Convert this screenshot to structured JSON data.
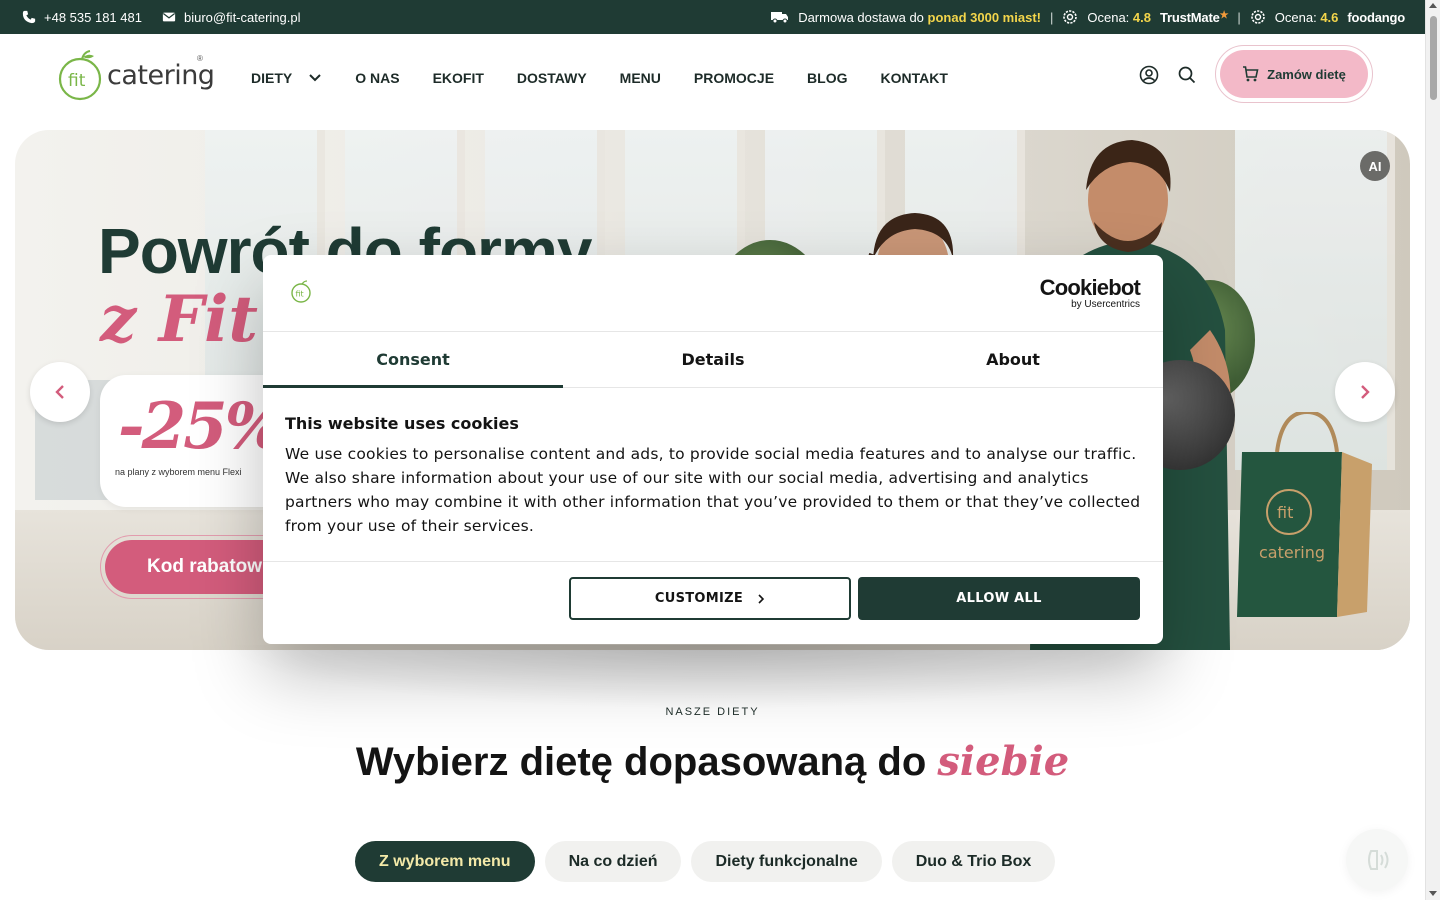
{
  "topbar": {
    "phone": "+48 535 181 481",
    "email": "biuro@fit-catering.pl",
    "delivery_prefix": "Darmowa dostawa do",
    "delivery_highlight": "ponad 3000 miast!",
    "separator": "|",
    "rating_label_1": "Ocena:",
    "rating_value_1": "4.8",
    "rating_brand_1": "TrustMate",
    "rating_label_2": "Ocena:",
    "rating_value_2": "4.6",
    "rating_brand_2": "foodango"
  },
  "header": {
    "logo_word": "catering",
    "logo_fit": "fit",
    "logo_reg": "®",
    "nav": [
      {
        "label": "DIETY"
      },
      {
        "label": "O NAS"
      },
      {
        "label": "EKOFIT"
      },
      {
        "label": "DOSTAWY"
      },
      {
        "label": "MENU"
      },
      {
        "label": "PROMOCJE"
      },
      {
        "label": "BLOG"
      },
      {
        "label": "KONTAKT"
      }
    ],
    "order_label": "Zamów dietę"
  },
  "hero": {
    "title_line1": "Powrót do formy",
    "title_line2": "z Fit C",
    "discount": "-25%",
    "discount_note": "na plany z wyborem menu Flexi",
    "code_button": "Kod rabatow",
    "ai_badge": "AI",
    "bag_logo_fit": "fit",
    "bag_logo_word": "catering"
  },
  "cookie_dialog": {
    "brand_name": "Cookiebot",
    "brand_by": "by Usercentrics",
    "tabs": [
      {
        "label": "Consent",
        "active": true
      },
      {
        "label": "Details",
        "active": false
      },
      {
        "label": "About",
        "active": false
      }
    ],
    "heading": "This website uses cookies",
    "body": "We use cookies to personalise content and ads, to provide social media features and to analyse our traffic. We also share information about your use of our site with our social media, advertising and analytics partners who may combine it with other information that you’ve provided to them or that they’ve collected from your use of their services.",
    "customize_label": "CUSTOMIZE",
    "allow_all_label": "ALLOW ALL"
  },
  "diets": {
    "kicker": "NASZE DIETY",
    "title_main": "Wybierz dietę dopasowaną do",
    "title_accent": "siebie",
    "pills": [
      {
        "label": "Z wyborem menu",
        "active": true
      },
      {
        "label": "Na co dzień",
        "active": false
      },
      {
        "label": "Diety funkcjonalne",
        "active": false
      },
      {
        "label": "Duo & Trio Box",
        "active": false
      }
    ]
  },
  "colors": {
    "brand_dark": "#1f3b34",
    "brand_pink": "#d35c7c",
    "highlight_yellow": "#f3d54b",
    "order_pink": "#f3b9c8"
  },
  "icons": {
    "phone": "phone-icon",
    "email": "mail-icon",
    "truck": "truck-icon",
    "rating": "gear-badge-icon",
    "user": "user-icon",
    "search": "search-icon",
    "cart": "cart-icon",
    "prev": "chevron-left-icon",
    "next": "chevron-right-icon",
    "chat": "chat-voice-icon"
  }
}
